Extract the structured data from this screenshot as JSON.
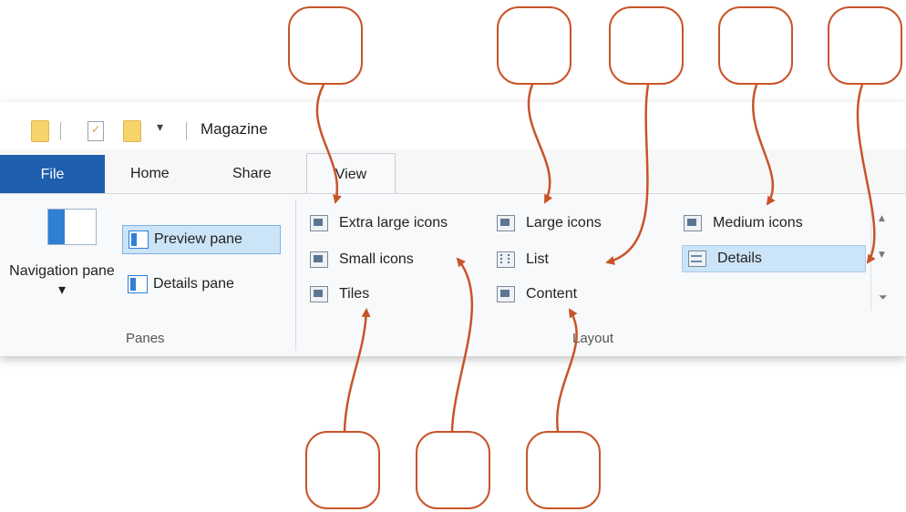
{
  "window": {
    "title": "Magazine",
    "qat_caret": "▾"
  },
  "tabs": {
    "file": "File",
    "home": "Home",
    "share": "Share",
    "view": "View"
  },
  "panes_group": {
    "label": "Panes",
    "navigation_pane": "Navigation pane ▾",
    "preview_pane": "Preview pane",
    "details_pane": "Details pane"
  },
  "layout_group": {
    "label": "Layout",
    "items": [
      {
        "label": "Extra large icons",
        "icon": "extra-large-icons-icon"
      },
      {
        "label": "Large icons",
        "icon": "large-icons-icon"
      },
      {
        "label": "Medium icons",
        "icon": "medium-icons-icon"
      },
      {
        "label": "Small icons",
        "icon": "small-icons-icon"
      },
      {
        "label": "List",
        "icon": "list-icon"
      },
      {
        "label": "Details",
        "icon": "details-icon",
        "selected": true
      },
      {
        "label": "Tiles",
        "icon": "tiles-icon"
      },
      {
        "label": "Content",
        "icon": "content-icon"
      }
    ],
    "scroll_up": "▲",
    "scroll_down": "▼",
    "scroll_more": "⏷"
  },
  "colors": {
    "accent": "#1f5fb0",
    "callout": "#c8542a",
    "selected_bg": "#cce4f7"
  }
}
